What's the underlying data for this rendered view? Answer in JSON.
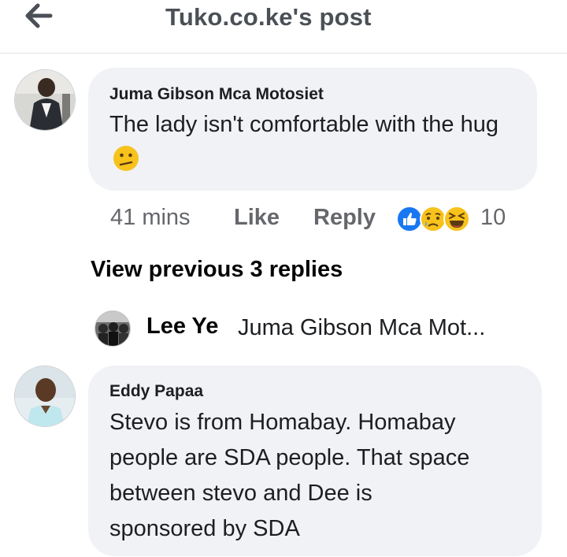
{
  "header": {
    "title": "Tuko.co.ke's post",
    "back_icon": "arrow-left-icon"
  },
  "comments": [
    {
      "author": "Juma Gibson Mca Motosiet",
      "text": "The lady isn't comfortable with the hug",
      "emoji": "confused-face-emoji",
      "time": "41 mins",
      "like_label": "Like",
      "reply_label": "Reply",
      "reactions": [
        "like-reaction-icon",
        "sad-reaction-icon",
        "haha-reaction-icon"
      ],
      "reaction_count": "10"
    },
    {
      "author": "Eddy Papaa",
      "text_lines": [
        "Stevo is from Homabay. Homabay",
        "people are SDA people. That space",
        "between stevo and Dee is",
        "sponsored by SDA"
      ]
    }
  ],
  "thread": {
    "view_previous_label": "View previous 3 replies",
    "reply_preview": {
      "author": "Lee Ye",
      "text": "Juma Gibson Mca Mot..."
    }
  },
  "colors": {
    "bubble": "#f0f2f5",
    "secondary_text": "#65676b",
    "like_blue": "#1877f2",
    "emoji_yellow": "#f7c21c"
  }
}
